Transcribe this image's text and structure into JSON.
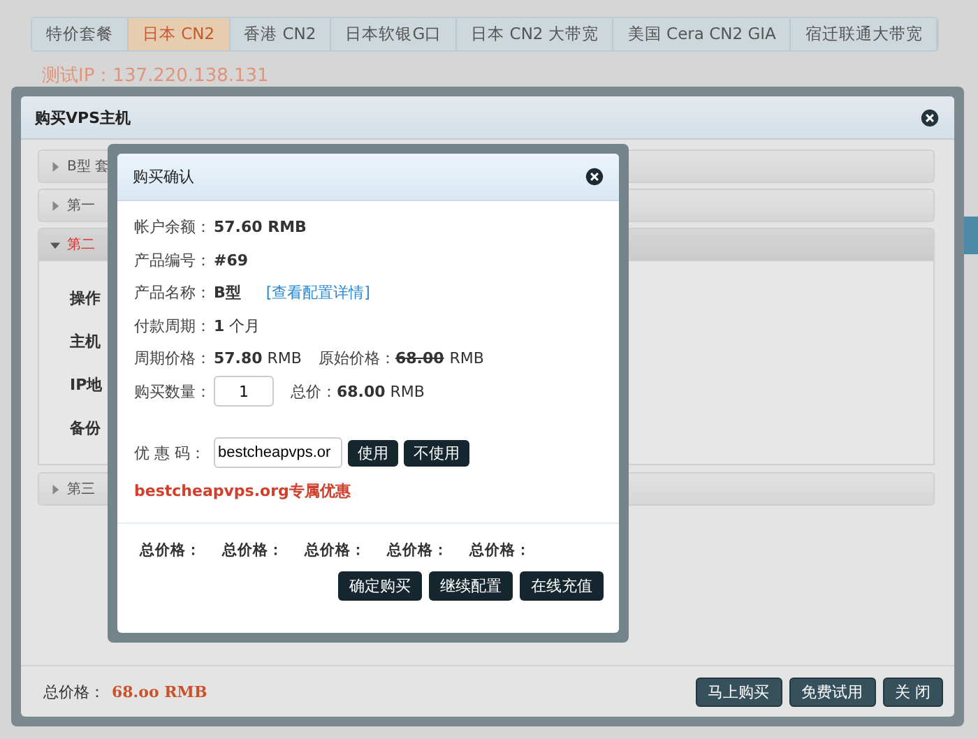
{
  "page": {
    "tabs": [
      {
        "label": "特价套餐",
        "selected": false
      },
      {
        "label": "日本 CN2",
        "selected": true
      },
      {
        "label": "香港 CN2",
        "selected": false
      },
      {
        "label": "日本软银G口",
        "selected": false
      },
      {
        "label": "日本 CN2 大带宽",
        "selected": false
      },
      {
        "label": "美国 Cera CN2 GIA",
        "selected": false
      },
      {
        "label": "宿迁联通大带宽",
        "selected": false
      }
    ],
    "test_ip": "测试IP：137.220.138.131"
  },
  "purchase_dialog": {
    "title": "购买VPS主机",
    "sections": [
      {
        "title": "B型 套",
        "expanded": false
      },
      {
        "title": "第一",
        "expanded": false
      },
      {
        "title": "第二",
        "expanded": true,
        "fields": [
          "操作",
          "主机",
          "IP地",
          "备份"
        ]
      },
      {
        "title": "第三",
        "expanded": false
      }
    ],
    "total_label": "总价格：",
    "total_value": "68.oo RMB",
    "buttons": [
      "马上购买",
      "免费试用",
      "关 闭"
    ]
  },
  "confirm_dialog": {
    "title": "购买确认",
    "rows": [
      {
        "kind": "text",
        "label": "帐户余额：",
        "value": "**57.60 RMB**"
      },
      {
        "kind": "text",
        "label": "产品编号：",
        "value": "**#69**"
      },
      {
        "kind": "link",
        "label": "产品名称：",
        "value": "**B型**",
        "link": "[查看配置详情]"
      },
      {
        "kind": "text",
        "label": "付款周期：",
        "value": "**1** 个月"
      },
      {
        "kind": "price",
        "label": "周期价格：",
        "value": "**57.80** RMB",
        "original_label": "原始价格：",
        "original_value": "68.00",
        "original_unit": "RMB",
        "struck": true
      },
      {
        "kind": "quantity",
        "label": "购买数量：",
        "quantity": "1",
        "total_label": "总价：",
        "total": "**68.00** RMB"
      }
    ],
    "coupon": {
      "label": "优 惠 码：",
      "value": "bestcheapvps.or",
      "buttons": [
        "使用",
        "不使用"
      ]
    },
    "promo": "bestcheapvps.org专属优惠",
    "totals": [
      "总价格：",
      "总价格：",
      "总价格：",
      "总价格：",
      "总价格："
    ],
    "buttons": [
      "确定购买",
      "继续配置",
      "在线充值"
    ]
  }
}
